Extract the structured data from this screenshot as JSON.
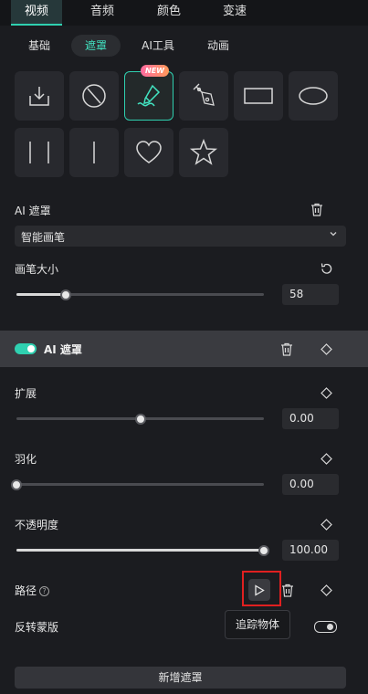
{
  "top_tabs": [
    "视频",
    "音频",
    "颜色",
    "变速"
  ],
  "sub_tabs": [
    "基础",
    "遮罩",
    "AI工具",
    "动画"
  ],
  "new_badge": "NEW",
  "ai_mask": {
    "label": "AI 遮罩",
    "mode_value": "智能画笔",
    "brush_size_label": "画笔大小",
    "brush_size_value": "58",
    "brush_size_fraction": 0.2
  },
  "section": {
    "title": "AI 遮罩",
    "enabled": true
  },
  "expand": {
    "label": "扩展",
    "value": "0.00",
    "fraction": 0.5
  },
  "feather": {
    "label": "羽化",
    "value": "0.00",
    "fraction": 0.0
  },
  "opacity": {
    "label": "不透明度",
    "value": "100.00",
    "fraction": 1.0
  },
  "path": {
    "label": "路径",
    "help": "?",
    "tooltip": "追踪物体"
  },
  "invert": {
    "label": "反转蒙版",
    "enabled": false
  },
  "add_mask_label": "新增遮罩",
  "colors": {
    "accent": "#2fd0b0",
    "highlight_box": "#e02020"
  }
}
